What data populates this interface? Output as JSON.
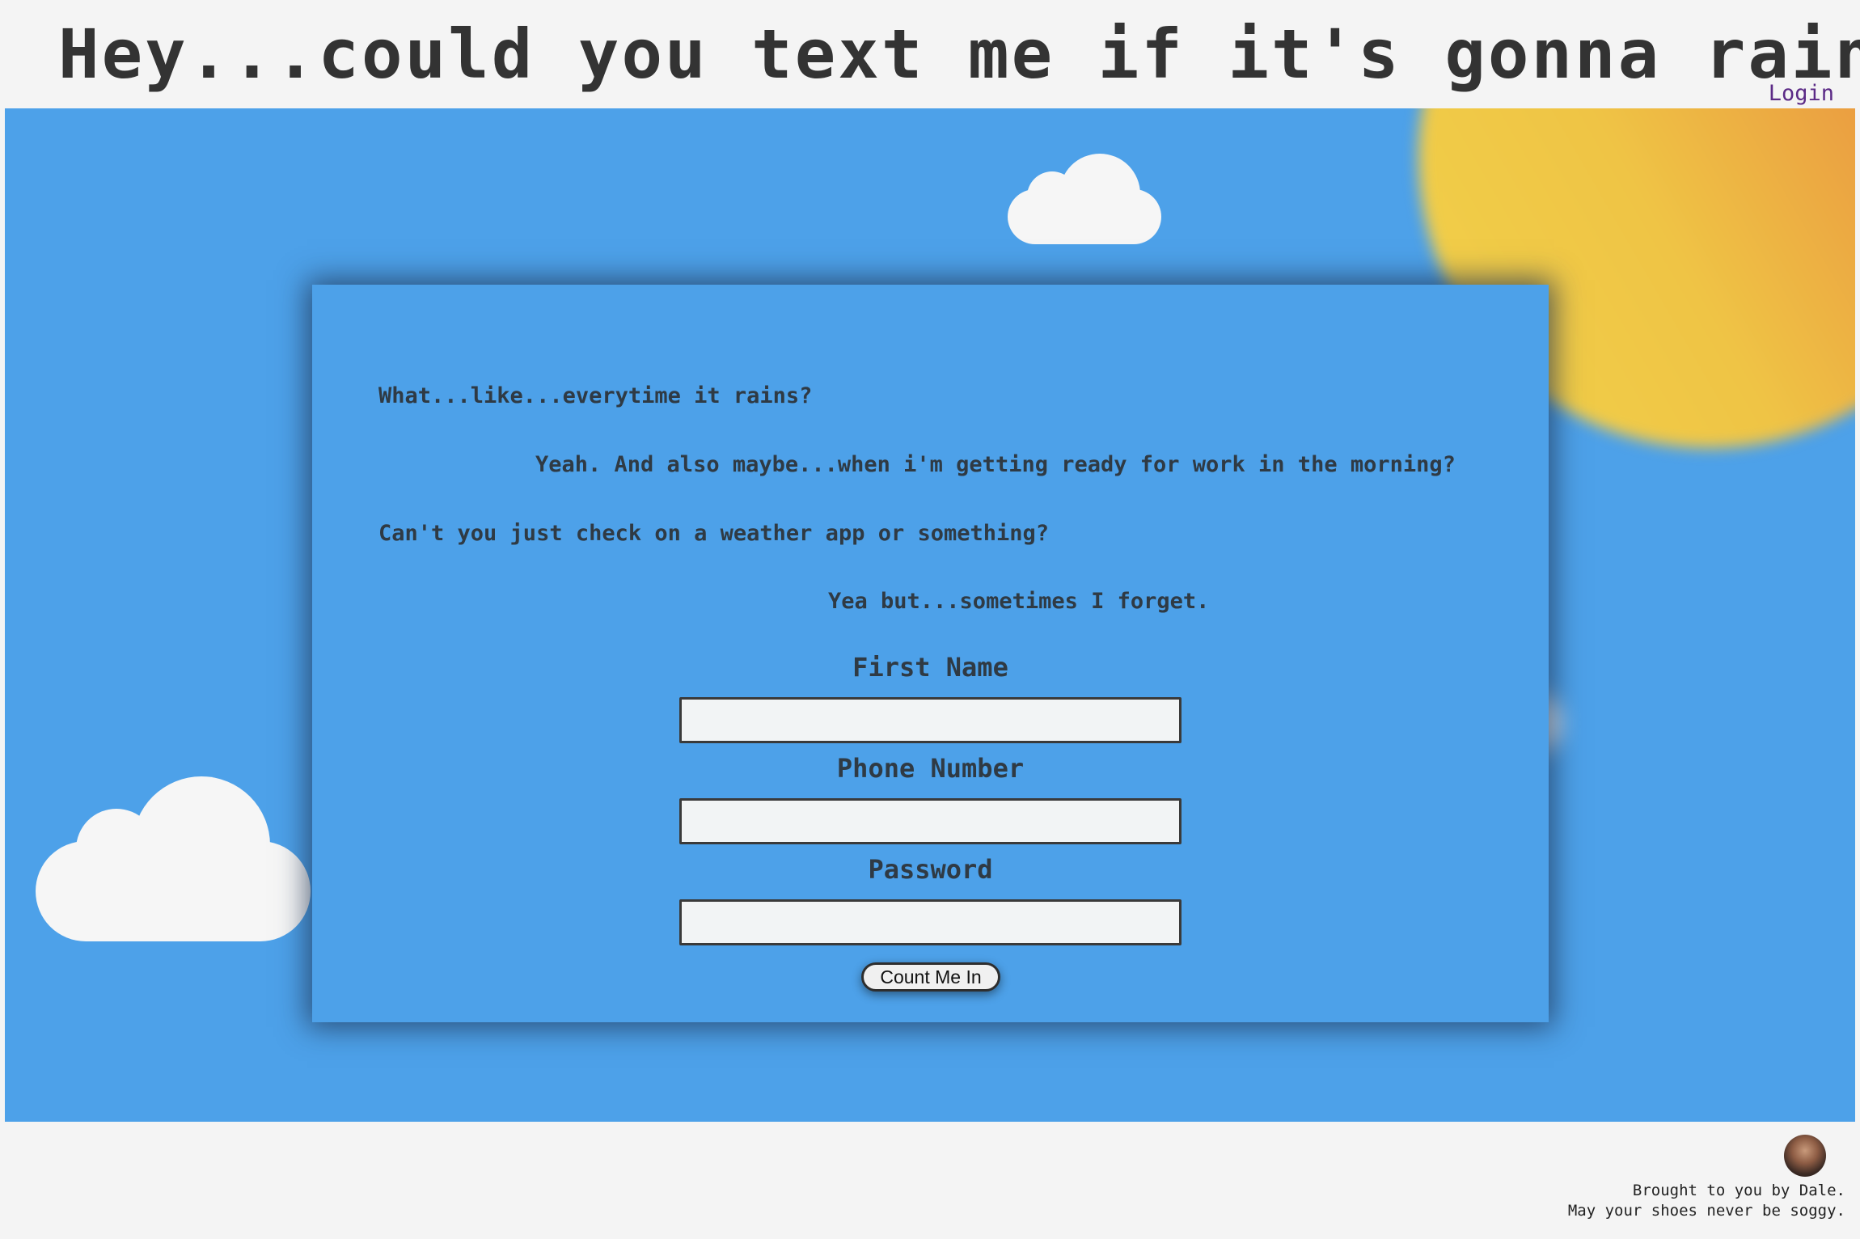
{
  "header": {
    "title": "Hey...could you text me if it's gonna rain?",
    "login_label": "Login"
  },
  "dialog": {
    "line1": "What...like...everytime it rains?",
    "line2": "Yeah. And also maybe...when i'm getting ready for work in the morning?",
    "line3": "Can't you just check on a weather app or something?",
    "line4": "Yea but...sometimes I forget."
  },
  "form": {
    "first_name_label": "First Name",
    "first_name_value": "",
    "phone_label": "Phone Number",
    "phone_value": "",
    "password_label": "Password",
    "password_value": "",
    "submit_label": "Count Me In"
  },
  "footer": {
    "credit_line1": "Brought to you by Dale.",
    "credit_line2": "May your shoes never be soggy.",
    "avatar_icon": "author-avatar"
  },
  "colors": {
    "sky": "#4da1e9",
    "sun_inner": "#f2d24a",
    "sun_outer": "#e36a3b",
    "cloud": "#f6f6f6",
    "text": "#333333",
    "login_link": "#5b2a86"
  }
}
